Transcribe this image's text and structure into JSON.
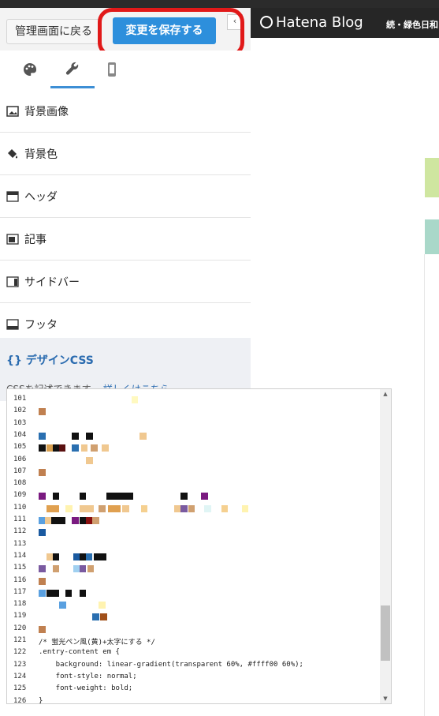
{
  "toolbar": {
    "back_label": "管理画面に戻る",
    "save_label": "変更を保存する",
    "collapse_icon": "‹"
  },
  "tabs": [
    {
      "icon": "palette-icon",
      "active": false
    },
    {
      "icon": "wrench-icon",
      "active": true
    },
    {
      "icon": "smartphone-icon",
      "active": false
    }
  ],
  "menu": {
    "items": [
      {
        "label": "背景画像",
        "icon": "image-icon"
      },
      {
        "label": "背景色",
        "icon": "paint-bucket-icon"
      },
      {
        "label": "ヘッダ",
        "icon": "header-layout-icon"
      },
      {
        "label": "記事",
        "icon": "article-layout-icon"
      },
      {
        "label": "サイドバー",
        "icon": "sidebar-layout-icon"
      },
      {
        "label": "フッタ",
        "icon": "footer-layout-icon"
      }
    ]
  },
  "design_css": {
    "title": "{} デザインCSS",
    "desc": "CSSを記述できます... ",
    "link": "詳しくはこちら"
  },
  "editor": {
    "lines": [
      {
        "n": "101",
        "text": ""
      },
      {
        "n": "102",
        "text": ""
      },
      {
        "n": "103",
        "text": ""
      },
      {
        "n": "104",
        "text": ""
      },
      {
        "n": "105",
        "text": ""
      },
      {
        "n": "106",
        "text": ""
      },
      {
        "n": "107",
        "text": ""
      },
      {
        "n": "108",
        "text": ""
      },
      {
        "n": "109",
        "text": ""
      },
      {
        "n": "110",
        "text": ""
      },
      {
        "n": "111",
        "text": ""
      },
      {
        "n": "112",
        "text": ""
      },
      {
        "n": "113",
        "text": ""
      },
      {
        "n": "114",
        "text": ""
      },
      {
        "n": "115",
        "text": ""
      },
      {
        "n": "116",
        "text": ""
      },
      {
        "n": "117",
        "text": ""
      },
      {
        "n": "118",
        "text": ""
      },
      {
        "n": "119",
        "text": ""
      },
      {
        "n": "120",
        "text": ""
      },
      {
        "n": "121",
        "text": "/* 蛍光ペン風(黄)+太字にする */"
      },
      {
        "n": "122",
        "text": ".entry-content em {"
      },
      {
        "n": "123",
        "text": "    background: linear-gradient(transparent 60%, #ffff00 60%);"
      },
      {
        "n": "124",
        "text": "    font-style: normal;"
      },
      {
        "n": "125",
        "text": "    font-weight: bold;"
      },
      {
        "n": "126",
        "text": "}"
      }
    ]
  },
  "preview": {
    "logo": "Hatena Blog",
    "blog_title": "続・緑色日和"
  },
  "colors": {
    "accent": "#2d8fdc",
    "annotation": "#e11919",
    "dark_bar": "#262626",
    "link": "#2b6cb0"
  }
}
